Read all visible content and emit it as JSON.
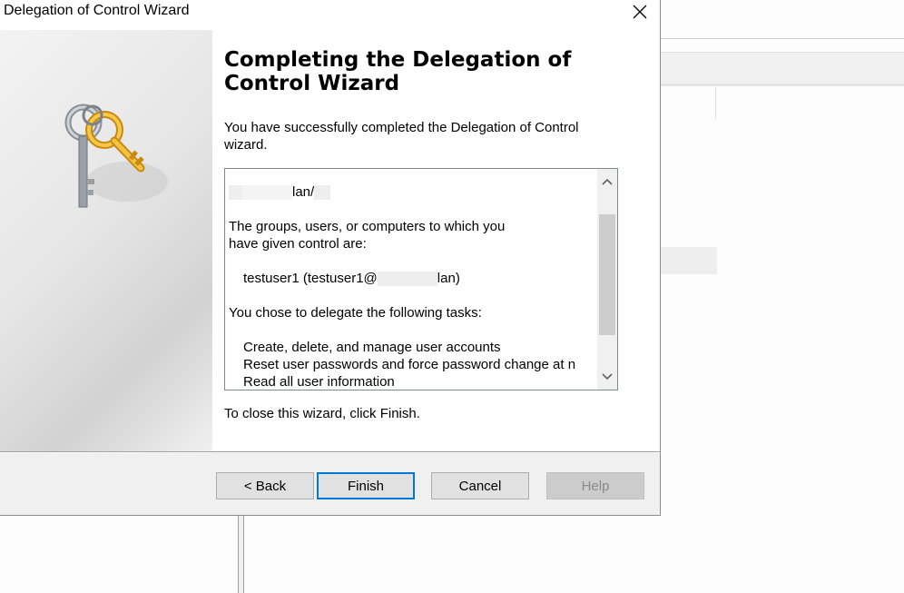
{
  "window": {
    "title": "Delegation of Control Wizard",
    "close_icon": "close-icon"
  },
  "sidebar": {
    "graphic_icon": "keys-icon"
  },
  "page": {
    "heading_line1": "Completing the Delegation of",
    "heading_line2": "Control Wizard",
    "intro_line1": "You have successfully completed the Delegation of Control",
    "intro_line2": "wizard.",
    "close_hint": "To close this wizard, click Finish."
  },
  "summary": {
    "object_suffix": "lan/",
    "groups_line1": "The groups, users, or computers to which you",
    "groups_line2": "have given control are:",
    "user_prefix": "testuser1 (testuser1@",
    "user_suffix": "lan)",
    "tasks_heading": "You chose to delegate the following tasks:",
    "task1": "Create, delete, and manage user accounts",
    "task2": "Reset user passwords and force password change at n",
    "task3_partial": "Read all user information"
  },
  "buttons": {
    "back": "< Back",
    "finish": "Finish",
    "cancel": "Cancel",
    "help": "Help"
  }
}
